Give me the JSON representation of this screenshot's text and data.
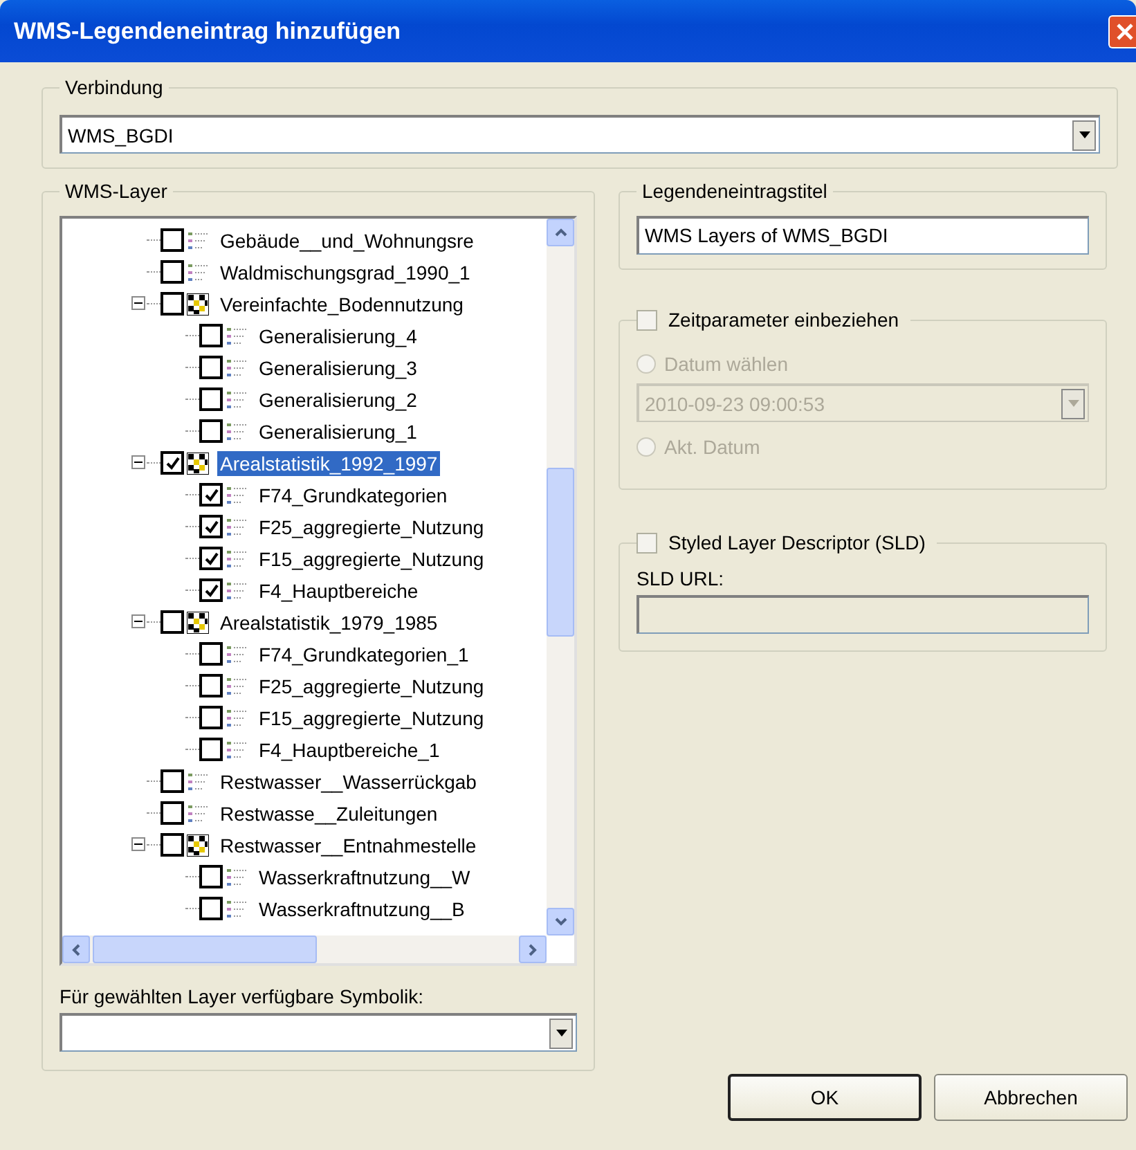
{
  "window": {
    "title": "WMS-Legendeneintrag hinzufügen"
  },
  "connection": {
    "label": "Verbindung",
    "value": "WMS_BGDI"
  },
  "layers": {
    "label": "WMS-Layer",
    "tree": [
      {
        "label": "Gebäude__und_Wohnungsre",
        "checked": false,
        "selected": false
      },
      {
        "label": "Waldmischungsgrad_1990_1",
        "checked": false,
        "selected": false
      },
      {
        "label": "Vereinfachte_Bodennutzung",
        "checked": false,
        "selected": false,
        "expanded": true,
        "children": [
          {
            "label": "Generalisierung_4",
            "checked": false,
            "selected": false
          },
          {
            "label": "Generalisierung_3",
            "checked": false,
            "selected": false
          },
          {
            "label": "Generalisierung_2",
            "checked": false,
            "selected": false
          },
          {
            "label": "Generalisierung_1",
            "checked": false,
            "selected": false
          }
        ]
      },
      {
        "label": "Arealstatistik_1992_1997",
        "checked": true,
        "selected": true,
        "expanded": true,
        "children": [
          {
            "label": "F74_Grundkategorien",
            "checked": true,
            "selected": false
          },
          {
            "label": "F25_aggregierte_Nutzung",
            "checked": true,
            "selected": false
          },
          {
            "label": "F15_aggregierte_Nutzung",
            "checked": true,
            "selected": false
          },
          {
            "label": "F4_Hauptbereiche",
            "checked": true,
            "selected": false
          }
        ]
      },
      {
        "label": "Arealstatistik_1979_1985",
        "checked": false,
        "selected": false,
        "expanded": true,
        "children": [
          {
            "label": "F74_Grundkategorien_1",
            "checked": false,
            "selected": false
          },
          {
            "label": "F25_aggregierte_Nutzung",
            "checked": false,
            "selected": false
          },
          {
            "label": "F15_aggregierte_Nutzung",
            "checked": false,
            "selected": false
          },
          {
            "label": "F4_Hauptbereiche_1",
            "checked": false,
            "selected": false
          }
        ]
      },
      {
        "label": "Restwasser__Wasserrückgab",
        "checked": false,
        "selected": false
      },
      {
        "label": "Restwasse__Zuleitungen",
        "checked": false,
        "selected": false
      },
      {
        "label": "Restwasser__Entnahmestelle",
        "checked": false,
        "selected": false,
        "expanded": true,
        "children": [
          {
            "label": "Wasserkraftnutzung__W",
            "checked": false,
            "selected": false
          },
          {
            "label": "Wasserkraftnutzung__B",
            "checked": false,
            "selected": false
          }
        ]
      }
    ]
  },
  "symbology": {
    "label": "Für gewählten Layer verfügbare Symbolik:"
  },
  "legend_title": {
    "label": "Legendeneintragstitel",
    "value": "WMS Layers of WMS_BGDI"
  },
  "time": {
    "label": "Zeitparameter einbeziehen",
    "checked": false,
    "date": "2010-09-23 09:00:53",
    "options": [
      {
        "label": "Datum wählen",
        "selected": false
      },
      {
        "label": "Akt. Datum",
        "selected": false
      }
    ]
  },
  "sld": {
    "label": "Styled Layer Descriptor (SLD)",
    "checked": false,
    "url_label": "SLD URL:"
  },
  "buttons": [
    {
      "label": "OK",
      "default": true
    },
    {
      "label": "Abbrechen",
      "default": false
    }
  ]
}
